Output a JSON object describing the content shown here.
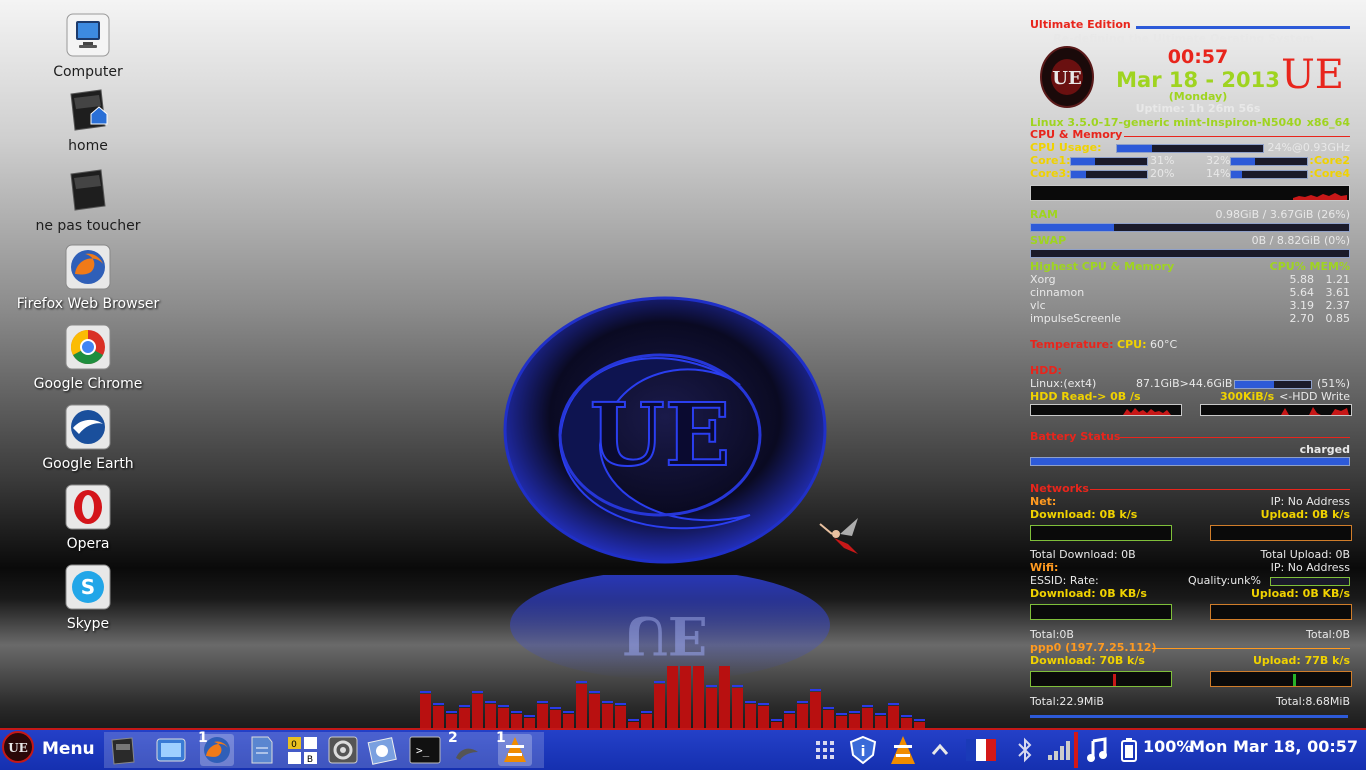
{
  "desktop_icons": [
    {
      "label": "Computer",
      "icon": "computer-icon"
    },
    {
      "label": "home",
      "icon": "home-folder-icon"
    },
    {
      "label": "ne pas toucher",
      "icon": "folder-icon"
    },
    {
      "label": "Firefox Web Browser",
      "icon": "firefox-icon"
    },
    {
      "label": "Google Chrome",
      "icon": "chrome-icon"
    },
    {
      "label": "Google Earth",
      "icon": "google-earth-icon"
    },
    {
      "label": "Opera",
      "icon": "opera-icon"
    },
    {
      "label": "Skype",
      "icon": "skype-icon"
    }
  ],
  "center_logo_text": "UE",
  "conky": {
    "title": "Ultimate Edition",
    "subtitle": "Re-defining the Ultimate Oerating System...",
    "time": "00:57",
    "date": "Mar 18 - 2013",
    "weekday": "(Monday)",
    "uptime": "Uptime: 1h 26m 56s",
    "ue_mark": "UE",
    "kernel": "Linux 3.5.0-17-generic mint-Inspiron-N5040",
    "arch": "x86_64",
    "cpu_mem_header": "CPU & Memory",
    "cpu_usage_label": "CPU Usage:",
    "cpu_usage_value": "24%@0.93GHz",
    "cpu_usage_pct": 24,
    "core1_label": "Core1:",
    "core1_value": "31%",
    "core1_pct": 31,
    "core2_value": "32%",
    "core2_label": ":Core2",
    "core2_pct": 32,
    "core3_label": "Core3:",
    "core3_value": "20%",
    "core3_pct": 20,
    "core4_value": "14%",
    "core4_label": ":Core4",
    "core4_pct": 14,
    "ram_label": "RAM",
    "ram_value": "0.98GiB / 3.67GiB (26%)",
    "ram_pct": 26,
    "swap_label": "SWAP",
    "swap_value": "0B   / 8.82GiB (0%)",
    "swap_pct": 0,
    "procs_header": "Highest CPU & Memory",
    "procs_cols": "CPU% MEM%",
    "processes": [
      {
        "name": "Xorg",
        "cpu": "5.88",
        "mem": "1.21"
      },
      {
        "name": "cinnamon",
        "cpu": "5.64",
        "mem": "3.61"
      },
      {
        "name": "vlc",
        "cpu": "3.19",
        "mem": "2.37"
      },
      {
        "name": "impulseScreenle",
        "cpu": "2.70",
        "mem": "0.85"
      }
    ],
    "temp_label": "Temperature:",
    "temp_cpu_label": "CPU:",
    "temp_cpu_value": "60°C",
    "hdd_header": "HDD:",
    "hdd_fs": "Linux:(ext4)",
    "hdd_size": "87.1GiB>44.6GiB",
    "hdd_pct_text": "(51%)",
    "hdd_pct": 51,
    "hdd_read_label": "HDD Read-> 0B  /s",
    "hdd_write_value": "300KiB/s",
    "hdd_write_label": "<-HDD Write",
    "battery_header": "Battery Status",
    "battery_status": "charged",
    "battery_pct": 100,
    "networks_header": "Networks",
    "net_label": "Net:",
    "net_ip": "IP: No Address",
    "net_download": "Download: 0B   k/s",
    "net_upload": "Upload:  0B   k/s",
    "total_download": "Total Download: 0B",
    "total_upload": "Total Upload: 0B",
    "wifi_label": "Wifi:",
    "wifi_ip": "IP: No Address",
    "essid": "ESSID: Rate:",
    "quality": "Quality:unk%",
    "wifi_download": "Download: 0B  KB/s",
    "wifi_upload": "Upload: 0B  KB/s",
    "wifi_total_left": "Total:0B",
    "wifi_total_right": "Total:0B",
    "ppp_label": "ppp0 (197.7.25.112)",
    "ppp_download": "Download: 70B   k/s",
    "ppp_upload": "Upload:  77B   k/s",
    "ppp_total_left": "Total:22.9MiB",
    "ppp_total_right": "Total:8.68MiB"
  },
  "taskbar": {
    "menu_label": "Menu",
    "workspace_numbers": [
      "1",
      "2",
      "1"
    ],
    "battery_percent": "100%",
    "clock": "Mon Mar 18, 00:57",
    "colors": {
      "panel": "#1530b0",
      "border": "#c41818"
    }
  }
}
